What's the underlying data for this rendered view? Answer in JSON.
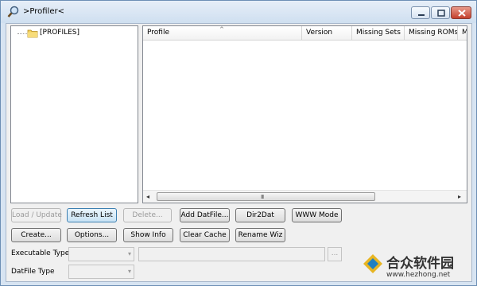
{
  "window": {
    "title": ">Profiler<"
  },
  "tree": {
    "root_label": "[PROFILES]"
  },
  "listview": {
    "columns": [
      "Profile",
      "Version",
      "Missing Sets",
      "Missing ROMs",
      "M"
    ],
    "scroll_grip": "III"
  },
  "buttons_row1": [
    "Load / Update",
    "Refresh List",
    "Delete...",
    "Add DatFile...",
    "Dir2Dat",
    "WWW Mode"
  ],
  "buttons_row2": [
    "Create...",
    "Options...",
    "Show Info",
    "Clear Cache",
    "Rename Wiz"
  ],
  "fields": {
    "executable_type_label": "Executable Type",
    "datfile_type_label": "DatFile Type",
    "browse_label": "..."
  },
  "watermark": {
    "text": "合众软件园",
    "url": "www.hezhong.net"
  }
}
